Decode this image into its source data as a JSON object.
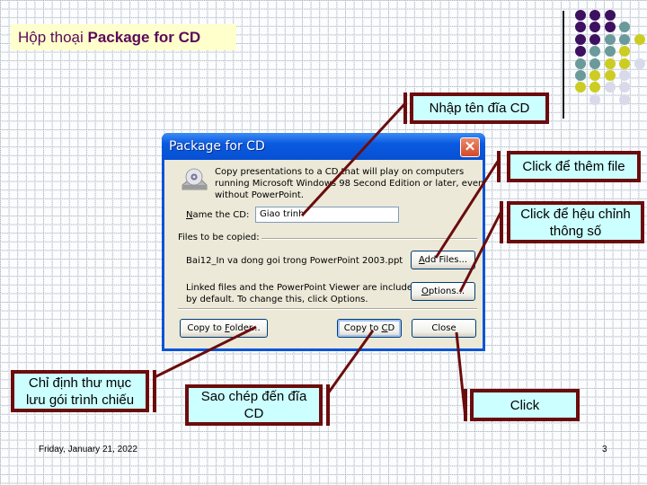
{
  "slide": {
    "title_prefix": "Hộp thoại ",
    "title_bold": "Package for CD",
    "footer_date": "Friday, January 21, 2022",
    "page_number": "3",
    "colors": {
      "title_text": "#5a0a5a",
      "title_bg": "#ffffcc",
      "callout_bg": "#ccffff",
      "callout_border": "#6b0c0c",
      "dot_purple": "#3d1060",
      "dot_teal": "#6a9a9a",
      "dot_yellow": "#cccc22",
      "dot_lavender": "#d8daea"
    },
    "dots": [
      [
        "purple",
        "purple",
        "purple",
        null,
        null
      ],
      [
        "purple",
        "purple",
        "purple",
        "teal",
        null
      ],
      [
        "purple",
        "purple",
        "teal",
        "teal",
        "yellow"
      ],
      [
        "purple",
        "teal",
        "teal",
        "yellow",
        null
      ],
      [
        "teal",
        "teal",
        "yellow",
        "yellow",
        "lavender"
      ],
      [
        "teal",
        "yellow",
        "yellow",
        "lavender",
        null
      ],
      [
        "yellow",
        "yellow",
        "lavender",
        "lavender",
        null
      ],
      [
        null,
        "lavender",
        null,
        "lavender",
        null
      ]
    ]
  },
  "dialog": {
    "title": "Package for CD",
    "close_icon": "close-icon",
    "description": "Copy presentations to a CD that will play on computers running Microsoft Windows 98 Second Edition or later, even without PowerPoint.",
    "name_label_u": "N",
    "name_label_rest": "ame the CD:",
    "name_value": "Giao trinh",
    "files_label": "Files to be copied:",
    "file_name": "Bai12_In va dong goi trong PowerPoint 2003.ppt",
    "linked_text": "Linked files and the PowerPoint Viewer are included by default. To change this, click Options.",
    "buttons": {
      "add_files_u": "A",
      "add_files_rest": "dd Files...",
      "options_u": "O",
      "options_rest": "ptions...",
      "copy_folder_pre": "Copy to ",
      "copy_folder_u": "F",
      "copy_folder_rest": "older...",
      "copy_cd_pre": "Copy to ",
      "copy_cd_u": "C",
      "copy_cd_rest": "D",
      "close": "Close"
    }
  },
  "callouts": {
    "name_cd": "Nhập tên đĩa CD",
    "add_file": "Click để thêm file",
    "options": "Click để hệu chỉnh thông số",
    "folder": "Chỉ định thư mục lưu gói trình chiếu",
    "copy_cd": "Sao chép đến đĩa CD",
    "close": "Click"
  }
}
